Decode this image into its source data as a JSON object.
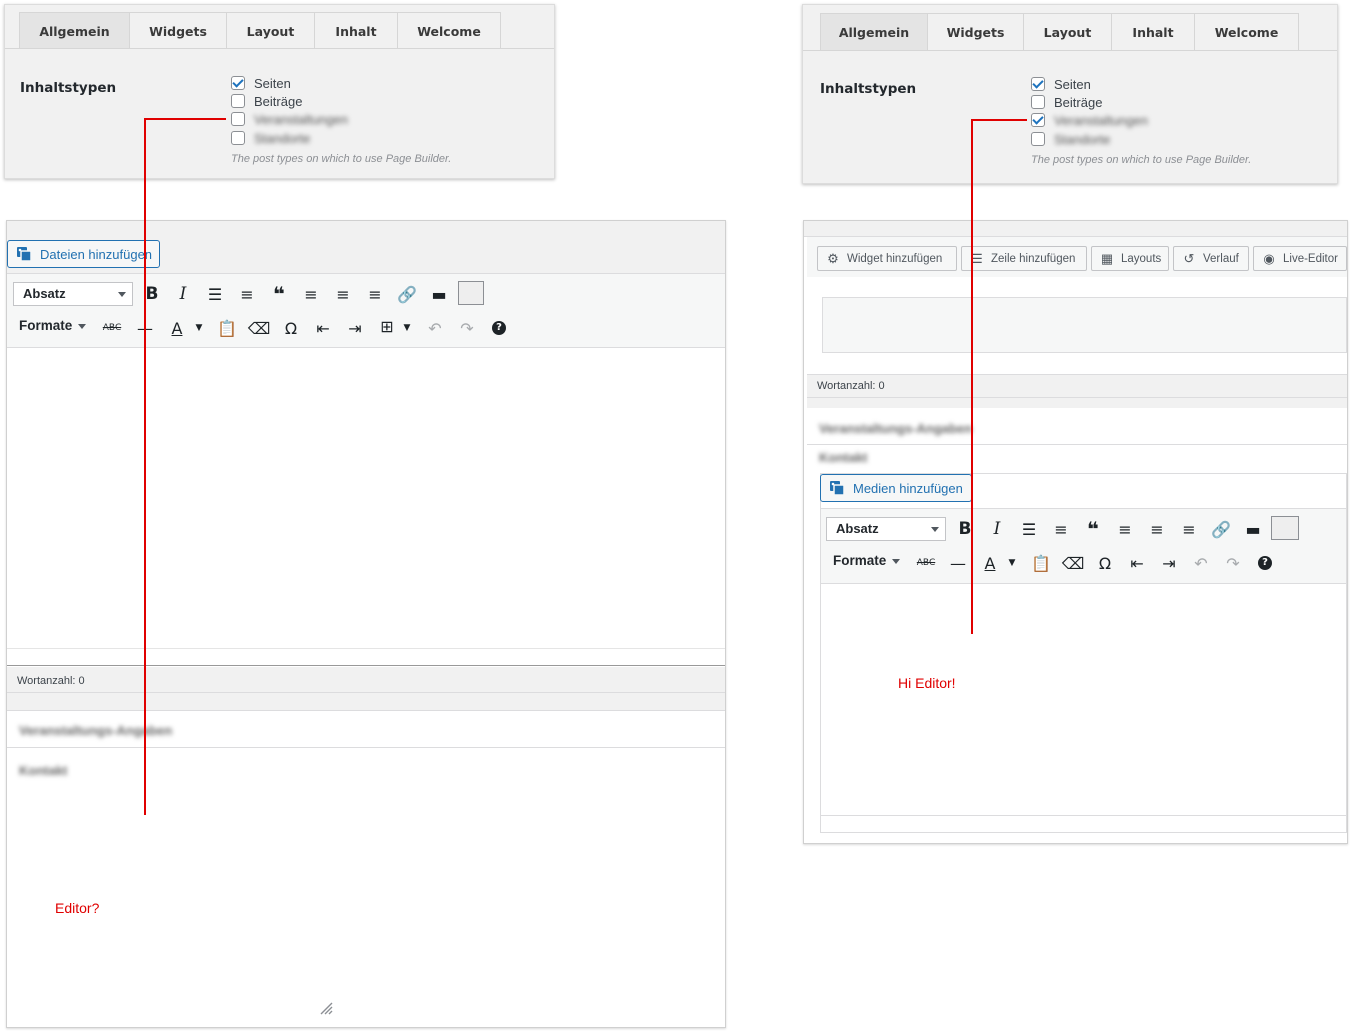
{
  "left_settings": {
    "tabs": [
      "Allgemein",
      "Widgets",
      "Layout",
      "Inhalt",
      "Welcome"
    ],
    "section_label": "Inhaltstypen",
    "post_types": [
      {
        "label": "Seiten",
        "checked": true,
        "blurred": false
      },
      {
        "label": "Beiträge",
        "checked": false,
        "blurred": false
      },
      {
        "label": "Veranstaltungen",
        "checked": false,
        "blurred": true
      },
      {
        "label": "Standorte",
        "checked": false,
        "blurred": true
      }
    ],
    "hint": "The post types on which to use Page Builder."
  },
  "right_settings": {
    "tabs": [
      "Allgemein",
      "Widgets",
      "Layout",
      "Inhalt",
      "Welcome"
    ],
    "section_label": "Inhaltstypen",
    "post_types": [
      {
        "label": "Seiten",
        "checked": true,
        "blurred": false
      },
      {
        "label": "Beiträge",
        "checked": false,
        "blurred": false
      },
      {
        "label": "Veranstaltungen",
        "checked": true,
        "blurred": true
      },
      {
        "label": "Standorte",
        "checked": false,
        "blurred": true
      }
    ],
    "hint": "The post types on which to use Page Builder."
  },
  "left_editor": {
    "media_button": "Dateien hinzufügen",
    "format_select": "Absatz",
    "formats_menu": "Formate",
    "word_count": "Wortanzahl: 0",
    "meta_title": "Veranstaltungs-Angaben",
    "meta_field": "Kontakt",
    "annotation": "Editor?"
  },
  "right_editor": {
    "pagebuilder_buttons": [
      "Widget hinzufügen",
      "Zeile hinzufügen",
      "Layouts",
      "Verlauf",
      "Live-Editor"
    ],
    "word_count": "Wortanzahl: 0",
    "meta_title": "Veranstaltungs-Angaben",
    "meta_field": "Kontakt",
    "media_button": "Medien hinzufügen",
    "format_select": "Absatz",
    "formats_menu": "Formate",
    "annotation": "Hi Editor!"
  },
  "colors": {
    "annotation": "#e00000",
    "link_blue": "#2271b1"
  }
}
